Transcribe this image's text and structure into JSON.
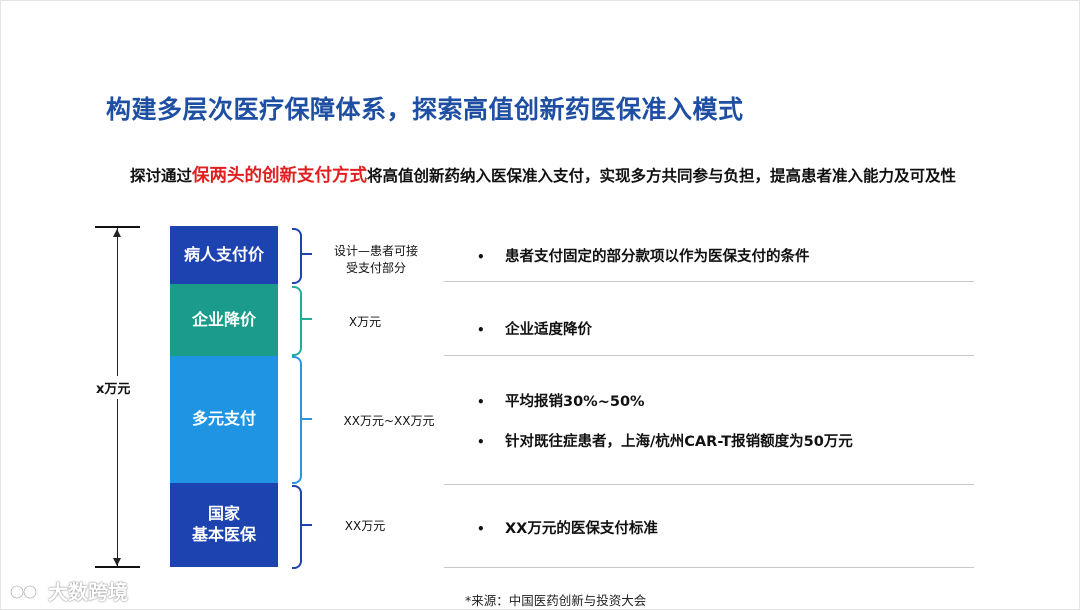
{
  "title": "构建多层次医疗保障体系，探索高值创新药医保准入模式",
  "subtitle": {
    "prefix": "探讨通过",
    "highlight": "保两头的创新支付方式",
    "suffix": "将高值创新药纳入医保准入支付，实现多方共同参与负担，提高患者准入能力及可及性"
  },
  "total_label": "x万元",
  "blocks": [
    {
      "label": "病人支付价",
      "amount": "设计—患者可接\n受支付部分",
      "bullets": [
        "患者支付固定的部分款项以作为医保支付的条件"
      ]
    },
    {
      "label": "企业降价",
      "amount": "X万元",
      "bullets": [
        "企业适度降价"
      ]
    },
    {
      "label": "多元支付",
      "amount": "XX万元~XX万元",
      "bullets": [
        "平均报销30%~50%",
        "针对既往症患者，上海/杭州CAR-T报销额度为50万元"
      ]
    },
    {
      "label": "国家\n基本医保",
      "amount": "XX万元",
      "bullets": [
        "XX万元的医保支付标准"
      ]
    }
  ],
  "bullet_marker": "•",
  "source": "*来源：中国医药创新与投资大会",
  "watermark": "大数跨境",
  "colors": {
    "title": "#1e4fa3",
    "highlight": "#e02020",
    "block_dark_blue": "#1d43b1",
    "block_teal": "#1b9c8a",
    "block_light_blue": "#1e94e3"
  }
}
